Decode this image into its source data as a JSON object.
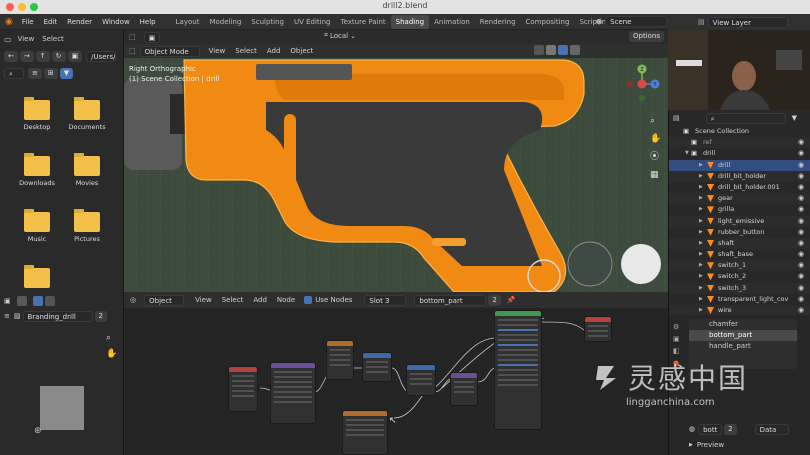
{
  "window": {
    "title": "drill2.blend",
    "traffic_colors": [
      "#fe5f57",
      "#febc2e",
      "#28c840"
    ]
  },
  "topbar": {
    "menu": [
      "File",
      "Edit",
      "Render",
      "Window",
      "Help"
    ],
    "workspaces": [
      "Layout",
      "Modeling",
      "Sculpting",
      "UV Editing",
      "Texture Paint",
      "Shading",
      "Animation",
      "Rendering",
      "Compositing",
      "Scripting"
    ],
    "active_workspace": "Shading",
    "add_tab": "+",
    "scene": "Scene",
    "view_layer": "View Layer"
  },
  "finder": {
    "nav": [
      "View",
      "Select"
    ],
    "path": "/Users/...",
    "items": [
      {
        "label": "Desktop"
      },
      {
        "label": "Documents"
      },
      {
        "label": "Downloads"
      },
      {
        "label": "Movies"
      },
      {
        "label": "Music"
      },
      {
        "label": "Pictures"
      },
      {
        "label": ""
      }
    ]
  },
  "viewport": {
    "mode": "Object Mode",
    "menu": [
      "View",
      "Select",
      "Add",
      "Object"
    ],
    "orientation": "Local",
    "options": "Options",
    "view_name": "Right Orthographic",
    "collection_info": "(1) Scene Collection | drill",
    "axes": {
      "y": "Y",
      "z": "Z"
    }
  },
  "outliner": {
    "header": "Scene Collection",
    "rows": [
      {
        "label": "ref",
        "kind": "collection",
        "depth": 1
      },
      {
        "label": "drill",
        "kind": "collection",
        "depth": 1
      },
      {
        "label": "drill",
        "kind": "object",
        "selected": true
      },
      {
        "label": "drill_bit_holder",
        "kind": "object"
      },
      {
        "label": "drill_bit_holder.001",
        "kind": "object"
      },
      {
        "label": "gear",
        "kind": "object"
      },
      {
        "label": "grilla",
        "kind": "object"
      },
      {
        "label": "light_emissive",
        "kind": "object"
      },
      {
        "label": "rubber_button",
        "kind": "object"
      },
      {
        "label": "shaft",
        "kind": "object"
      },
      {
        "label": "shaft_base",
        "kind": "object"
      },
      {
        "label": "switch_1",
        "kind": "object"
      },
      {
        "label": "switch_2",
        "kind": "object"
      },
      {
        "label": "switch_3",
        "kind": "object"
      },
      {
        "label": "transparent_light_cov",
        "kind": "object"
      },
      {
        "label": "wire",
        "kind": "object"
      }
    ]
  },
  "image_editor": {
    "image_name": "Branding_drill",
    "users": "2"
  },
  "node_editor": {
    "object": "Object",
    "menu": [
      "View",
      "Select",
      "Add",
      "Node"
    ],
    "use_nodes": "Use Nodes",
    "slot": "Slot 3",
    "material": "bottom_part",
    "users": "2"
  },
  "properties": {
    "materials": [
      "chamfer",
      "bottom_part",
      "handle_part"
    ],
    "active_material": "bottom_part",
    "field": "bott",
    "users": "2",
    "data": "Data",
    "preview": "Preview"
  },
  "watermark": {
    "cn": "灵感中国",
    "url": "lingganchina.com"
  }
}
